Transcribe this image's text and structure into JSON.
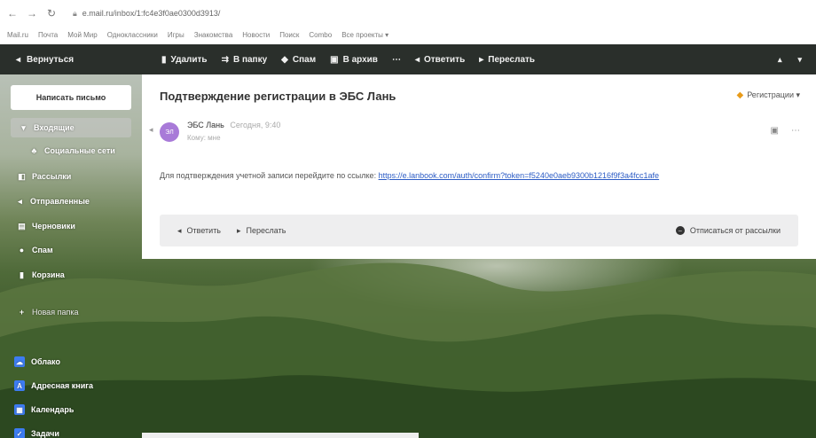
{
  "browser": {
    "url": "e.mail.ru/inbox/1:fc4e3f0ae0300d3913/",
    "bookmarks": [
      "Mail.ru",
      "Почта",
      "Мой Мир",
      "Одноклассники",
      "Игры",
      "Знакомства",
      "Новости",
      "Поиск",
      "Combo",
      "Все проекты ▾"
    ]
  },
  "toolbar": {
    "back": "Вернуться",
    "actions": [
      {
        "icon": "trash-icon",
        "glyph": "▮",
        "label": "Удалить"
      },
      {
        "icon": "move-icon",
        "glyph": "⇉",
        "label": "В папку"
      },
      {
        "icon": "spam-icon",
        "glyph": "◆",
        "label": "Спам"
      },
      {
        "icon": "archive-icon",
        "glyph": "▣",
        "label": "В архив"
      },
      {
        "icon": "more-icon",
        "glyph": "⋯",
        "label": ""
      },
      {
        "icon": "reply-icon",
        "glyph": "◂",
        "label": "Ответить"
      },
      {
        "icon": "forward-icon",
        "glyph": "▸",
        "label": "Переслать"
      }
    ]
  },
  "sidebar": {
    "compose": "Написать письмо",
    "items": [
      {
        "label": "Входящие",
        "icon": "inbox-icon",
        "glyph": "▾",
        "active": true
      },
      {
        "label": "Социальные сети",
        "icon": "people-icon",
        "glyph": "♣"
      },
      {
        "label": "Рассылки",
        "icon": "newsletter-icon",
        "glyph": "◧"
      },
      {
        "label": "Отправленные",
        "icon": "sent-icon",
        "glyph": "◂"
      },
      {
        "label": "Черновики",
        "icon": "drafts-icon",
        "glyph": "▤"
      },
      {
        "label": "Спам",
        "icon": "spam-icon",
        "glyph": "●"
      },
      {
        "label": "Корзина",
        "icon": "trash-icon",
        "glyph": "▮"
      },
      {
        "label": "Новая папка",
        "icon": "plus-icon",
        "glyph": "+"
      }
    ],
    "apps": [
      {
        "label": "Облако",
        "icon": "cloud-icon",
        "glyph": "☁",
        "color": "#3d7cf2"
      },
      {
        "label": "Адресная книга",
        "icon": "contacts-icon",
        "glyph": "A",
        "color": "#3d7cf2"
      },
      {
        "label": "Календарь",
        "icon": "calendar-icon",
        "glyph": "▦",
        "color": "#3d7cf2"
      },
      {
        "label": "Задачи",
        "icon": "tasks-icon",
        "glyph": "✓",
        "color": "#3d7cf2"
      }
    ]
  },
  "message": {
    "subject": "Подтверждение регистрации в ЭБС Лань",
    "label": "Регистрации ▾",
    "avatar": "ЭЛ",
    "sender": "ЭБС Лань",
    "time": "Сегодня, 9:40",
    "recipient": "Кому: мне",
    "body": "Для подтверждения учетной записи перейдите по ссылке: ",
    "link": "https://e.lanbook.com/auth/confirm?token=f5240e0aeb9300b1216f9f3a4fcc1afe",
    "reply": "Ответить",
    "forward": "Переслать",
    "unsubscribe": "Отписаться от рассылки"
  }
}
